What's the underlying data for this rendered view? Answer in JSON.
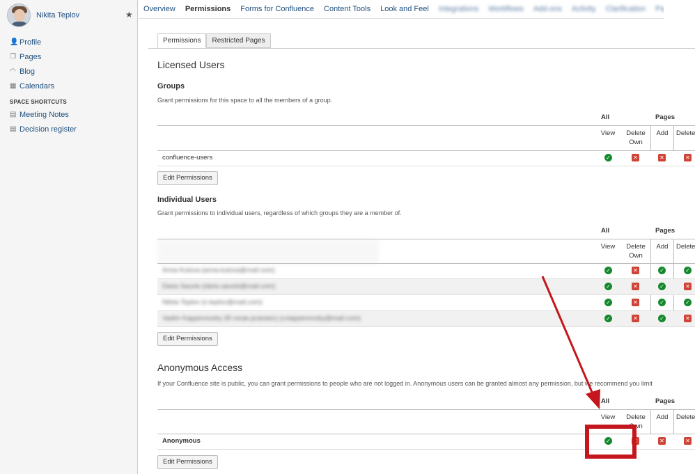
{
  "sidebar": {
    "user_name": "Nikita Teplov",
    "items": [
      {
        "label": "Profile",
        "icon": "person-icon"
      },
      {
        "label": "Pages",
        "icon": "pages-icon"
      },
      {
        "label": "Blog",
        "icon": "rss-icon"
      },
      {
        "label": "Calendars",
        "icon": "calendar-icon"
      }
    ],
    "section_title": "SPACE SHORTCUTS",
    "shortcuts": [
      {
        "label": "Meeting Notes",
        "icon": "page-icon"
      },
      {
        "label": "Decision register",
        "icon": "page-icon"
      }
    ]
  },
  "top_tabs": [
    {
      "label": "Overview"
    },
    {
      "label": "Permissions"
    },
    {
      "label": "Forms for Confluence"
    },
    {
      "label": "Content Tools"
    },
    {
      "label": "Look and Feel"
    },
    {
      "label": "Integrations"
    },
    {
      "label": "Workflows"
    },
    {
      "label": "Add-ons"
    },
    {
      "label": "Activity"
    },
    {
      "label": "Clarification"
    },
    {
      "label": "Page Approval"
    }
  ],
  "sub_tabs": {
    "permissions": "Permissions",
    "restricted": "Restricted Pages"
  },
  "licensed_title": "Licensed Users",
  "groups": {
    "title": "Groups",
    "desc": "Grant permissions for this space to all the members of a group.",
    "rows": [
      {
        "label": "confluence-users"
      }
    ],
    "edit": "Edit Permissions"
  },
  "individual": {
    "title": "Individual Users",
    "desc": "Grant permissions to individual users, regardless of which groups they are a member of.",
    "rows": [
      {
        "label": "Anna Kulova (anna.kulova@mail.com)"
      },
      {
        "label": "Daria Sauvie (daria.sauvie@mail.com)"
      },
      {
        "label": "Nikita Teplov (n.teplov@mail.com)"
      },
      {
        "label": "Vadim Kappenovsky (fil vsrae.pcaraeic) (v.kappenovsky@mail.com)"
      }
    ],
    "edit": "Edit Permissions"
  },
  "anonymous": {
    "title": "Anonymous Access",
    "desc": "If your Confluence site is public, you can grant permissions to people who are not logged in. Anonymous users can be granted almost any permission, but we recommend you limit",
    "rows": [
      {
        "label": "Anonymous"
      }
    ],
    "edit": "Edit Permissions"
  },
  "table_headers": {
    "all": "All",
    "pages": "Pages",
    "view": "View",
    "delete_own_1": "Delete",
    "delete_own_2": "Own",
    "add": "Add",
    "delete": "Delete"
  },
  "status_colors": {
    "yes": "#14892c",
    "no": "#d04437",
    "annotation": "#c4161c"
  }
}
